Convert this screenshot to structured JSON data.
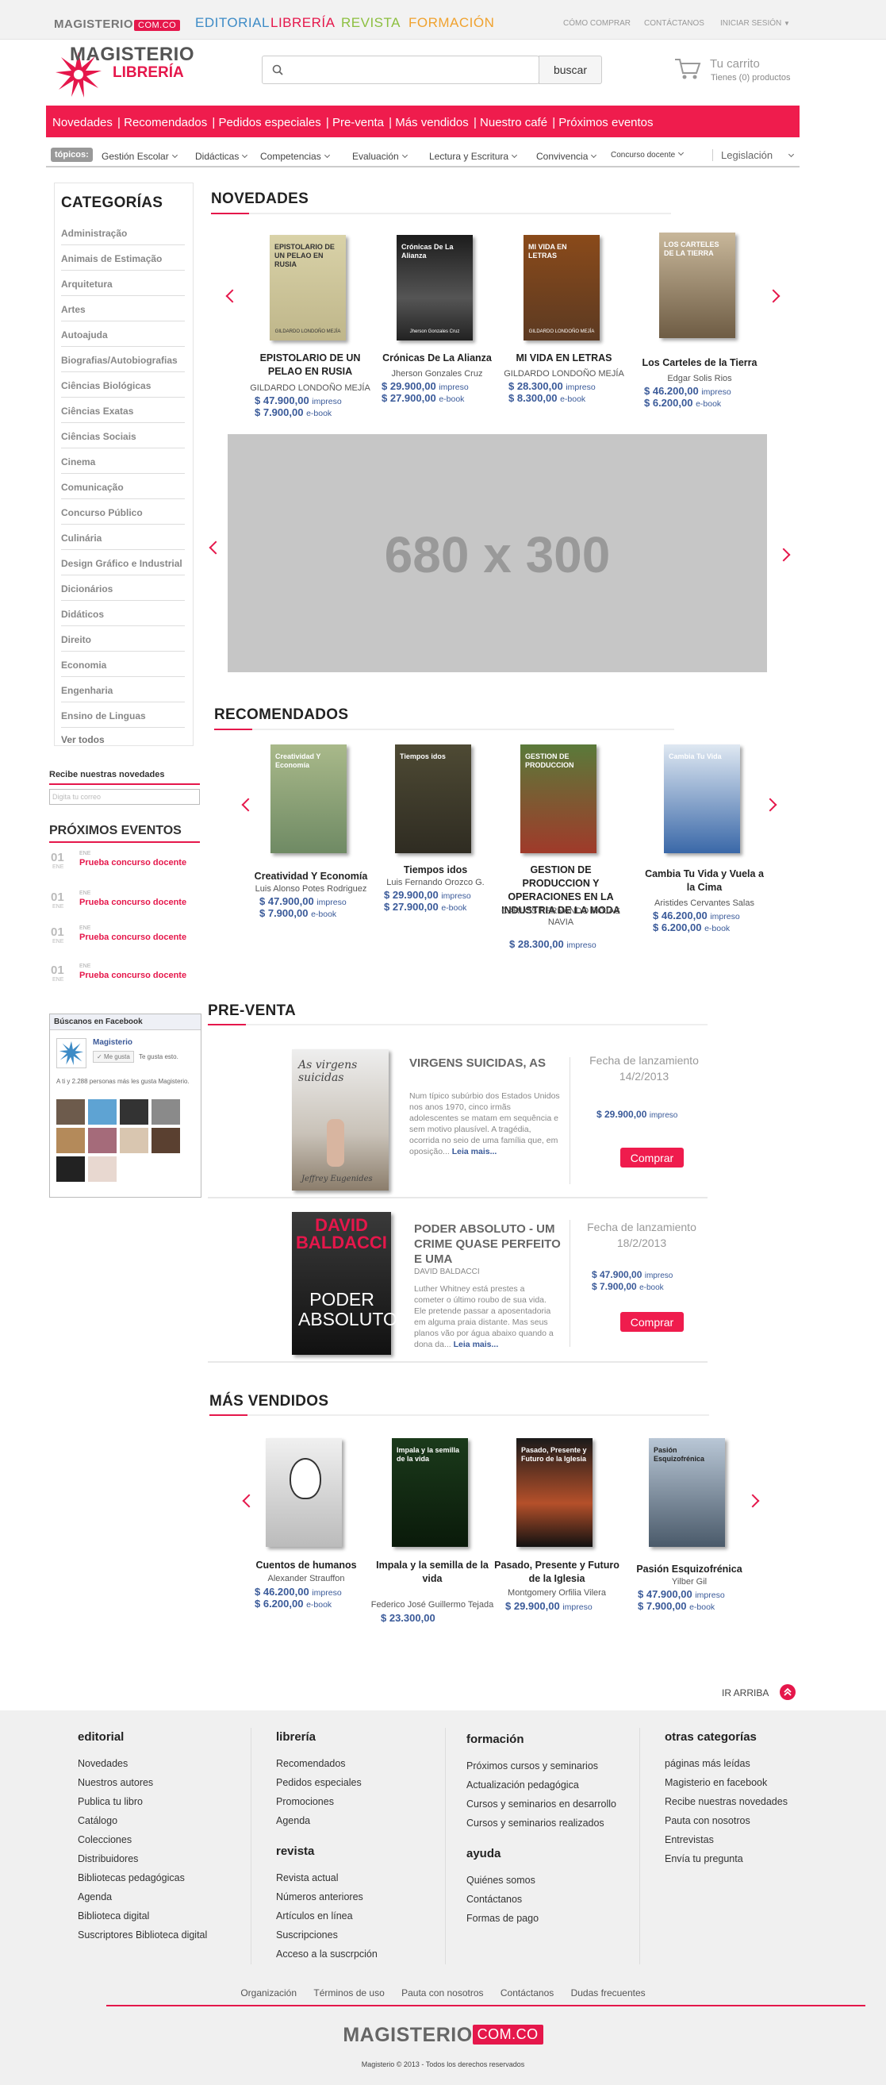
{
  "topbar": {
    "brand": "MAGISTERIO",
    "brand_suffix": "COM.CO",
    "nav": [
      {
        "label": "EDITORIAL",
        "color": "#3d8bc6"
      },
      {
        "label": "LIBRERÍA",
        "color": "#e5174b"
      },
      {
        "label": "REVISTA",
        "color": "#8cbf3f"
      },
      {
        "label": "FORMACIÓN",
        "color": "#f0a22e"
      }
    ],
    "right": [
      "CÓMO COMPRAR",
      "CONTÁCTANOS",
      "INICIAR SESIÓN"
    ]
  },
  "logo": {
    "line1": "MAGISTERIO",
    "line2": "LIBRERÍA"
  },
  "search": {
    "placeholder": "",
    "button": "buscar"
  },
  "cart": {
    "title": "Tu carrito",
    "status": "Tienes (0) productos"
  },
  "rednav": [
    "Novedades",
    "Recomendados",
    "Pedidos especiales",
    "Pre-venta",
    "Más vendidos",
    "Nuestro café",
    "Próximos eventos"
  ],
  "topics": {
    "label": "tópicos:",
    "items": [
      "Gestión Escolar",
      "Didácticas",
      "Competencias",
      "Evaluación",
      "Lectura y Escritura",
      "Convivencia",
      "Concurso docente",
      "Legislación"
    ]
  },
  "sidebar": {
    "title": "CATEGORÍAS",
    "items": [
      "Administração",
      "Animais de Estimação",
      "Arquitetura",
      "Artes",
      "Autoajuda",
      "Biografias/Autobiografias",
      "Ciências Biológicas",
      "Ciências Exatas",
      "Ciências Sociais",
      "Cinema",
      "Comunicação",
      "Concurso Público",
      "Culinária",
      "Design Gráfico e Industrial",
      "Dicionários",
      "Didáticos",
      "Direito",
      "Economia",
      "Engenharia",
      "Ensino de Linguas"
    ],
    "see_all": "Ver todos"
  },
  "novedades": {
    "title": "NOVEDADES",
    "books": [
      {
        "title": "EPISTOLARIO DE UN PELAO EN RUSIA",
        "author": "GILDARDO LONDOÑO MEJÍA",
        "price1": "$ 47.900,00",
        "type1": "impreso",
        "price2": "$  7.900,00",
        "type2": "e-book",
        "cover_title": "EPISTOLARIO DE UN PELAO EN RUSIA",
        "cover_author": "GILDARDO LONDOÑO MEJÍA"
      },
      {
        "title": "Crónicas De La Alianza",
        "author": "Jherson Gonzales Cruz",
        "price1": "$ 29.900,00",
        "type1": "impreso",
        "price2": "$ 27.900,00",
        "type2": "e-book",
        "cover_title": "Crónicas De La Alianza",
        "cover_author": "Jherson Gonzales Cruz"
      },
      {
        "title": "MI VIDA EN LETRAS",
        "author": "GILDARDO LONDOÑO MEJÍA",
        "price1": "$ 28.300,00",
        "type1": "impreso",
        "price2": "$  8.300,00",
        "type2": "e-book",
        "cover_title": "MI VIDA EN LETRAS",
        "cover_author": "GILDARDO LONDOÑO MEJÍA"
      },
      {
        "title": "Los Carteles de la Tierra",
        "author": "Edgar Solis Rios",
        "price1": "$ 46.200,00",
        "type1": "impreso",
        "price2": "$  6.200,00",
        "type2": "e-book",
        "cover_title": "LOS CARTELES DE LA TIERRA",
        "cover_author": ""
      }
    ]
  },
  "banner": {
    "text": "680 x 300"
  },
  "recomendados": {
    "title": "RECOMENDADOS",
    "books": [
      {
        "title": "Creatividad Y Economía",
        "author": "Luis Alonso Potes Rodriguez",
        "price1": "$ 47.900,00",
        "type1": "impreso",
        "price2": "$  7.900,00",
        "type2": "e-book",
        "cover_title": "Creatividad Y Economía"
      },
      {
        "title": "Tiempos idos",
        "author": "Luis Fernando Orozco G.",
        "price1": "$ 29.900,00",
        "type1": "impreso",
        "price2": "$ 27.900,00",
        "type2": "e-book",
        "cover_title": "Tiempos idos"
      },
      {
        "title": "GESTION DE PRODUCCION Y OPERACIONES EN LA INDUSTRIA DE LA MODA",
        "author": "CARLOS FERNANDO ROJAS NAVIA",
        "price1": "$ 28.300,00",
        "type1": "impreso",
        "price2": "",
        "type2": "",
        "cover_title": "GESTION DE PRODUCCION"
      },
      {
        "title": "Cambia Tu Vida y Vuela a la Cima",
        "author": "Aristides Cervantes Salas",
        "price1": "$ 46.200,00",
        "type1": "impreso",
        "price2": "$  6.200,00",
        "type2": "e-book",
        "cover_title": "Cambia Tu Vida"
      }
    ]
  },
  "newsletter": {
    "title": "Recibe nuestras novedades",
    "placeholder": "Digita tu correo"
  },
  "events": {
    "title": "PRÓXIMOS EVENTOS",
    "items": [
      {
        "day": "01",
        "month": "ENE",
        "name": "Prueba concurso docente"
      },
      {
        "day": "01",
        "month": "ENE",
        "name": "Prueba concurso docente"
      },
      {
        "day": "01",
        "month": "ENE",
        "name": "Prueba concurso docente"
      },
      {
        "day": "01",
        "month": "ENE",
        "name": "Prueba concurso docente"
      }
    ]
  },
  "facebook": {
    "header": "Búscanos en Facebook",
    "page": "Magisterio",
    "like": "Me gusta",
    "like_text": "Te gusta esto.",
    "people": "A ti y 2.288 personas más les gusta Magisterio."
  },
  "preventa": {
    "title": "PRE-VENTA",
    "date_label": "Fecha de lanzamiento",
    "buy": "Comprar",
    "items": [
      {
        "title": "VIRGENS SUICIDAS, AS",
        "author": "",
        "desc": "Num típico subúrbio dos Estados Unidos nos anos 1970, cinco irmãs adolescentes se matam em sequência e sem motivo plausível. A tragédia, ocorrida no seio de uma família que, em oposição...",
        "more": "Leia mais...",
        "date": "14/2/2013",
        "price1": "$ 29.900,00",
        "type1": "impreso",
        "price2": "",
        "type2": "",
        "cover_title": "As virgens suicidas",
        "cover_author": "Jeffrey Eugenides"
      },
      {
        "title": "PODER ABSOLUTO - UM CRIME QUASE PERFEITO E UMA",
        "author": "DAVID BALDACCI",
        "desc": "Luther Whitney está prestes a cometer o último roubo de sua vida. Ele pretende passar a aposentadoria em alguma praia distante. Mas seus planos vão por água abaixo quando a dona da...",
        "more": "Leia mais...",
        "date": "18/2/2013",
        "price1": "$ 47.900,00",
        "type1": "impreso",
        "price2": "$  7.900,00",
        "type2": "e-book",
        "cover_title": "PODER ABSOLUTO",
        "cover_author": "DAVID BALDACCI"
      }
    ]
  },
  "masvendidos": {
    "title": "MÁS VENDIDOS",
    "books": [
      {
        "title": "Cuentos de humanos",
        "author": "Alexander Strauffon",
        "price1": "$ 46.200,00",
        "type1": "impreso",
        "price2": "$  6.200,00",
        "type2": "e-book",
        "cover_title": ""
      },
      {
        "title": "Impala y la semilla de la vida",
        "author": "Federico José Guillermo Tejada",
        "price1": "$ 23.300,00",
        "type1": "",
        "price2": "",
        "type2": "",
        "cover_title": "Impala y la semilla de la vida"
      },
      {
        "title": "Pasado, Presente y Futuro de la Iglesia",
        "author": "Montgomery Orfilia Vilera",
        "price1": "$ 29.900,00",
        "type1": "impreso",
        "price2": "",
        "type2": "",
        "cover_title": "Pasado, Presente y Futuro de la Iglesia"
      },
      {
        "title": "Pasión Esquizofrénica",
        "author": "Yilber Gil",
        "price1": "$ 47.900,00",
        "type1": "impreso",
        "price2": "$  7.900,00",
        "type2": "e-book",
        "cover_title": "Pasión Esquizofrénica"
      }
    ]
  },
  "irarriba": "IR ARRIBA",
  "footer": {
    "editorial": {
      "title": "editorial",
      "items": [
        "Novedades",
        "Nuestros autores",
        "Publica tu libro",
        "Catálogo",
        "Colecciones",
        "Distribuidores",
        "Bibliotecas pedagógicas",
        "Agenda",
        "Biblioteca digital",
        "Suscriptores Biblioteca digital"
      ]
    },
    "libreria": {
      "title": "librería",
      "items": [
        "Recomendados",
        "Pedidos especiales",
        "Promociones",
        "Agenda"
      ]
    },
    "revista": {
      "title": "revista",
      "items": [
        "Revista actual",
        "Números anteriores",
        "Artículos en línea",
        "Suscripciones",
        "Acceso a la suscrpción"
      ]
    },
    "formacion": {
      "title": "formación",
      "items": [
        "Próximos cursos y seminarios",
        "Actualización pedagógica",
        "Cursos y seminarios en desarrollo",
        "Cursos y seminarios realizados"
      ]
    },
    "ayuda": {
      "title": "ayuda",
      "items": [
        "Quiénes somos",
        "Contáctanos",
        "Formas de pago"
      ]
    },
    "otras": {
      "title": "otras categorías",
      "items": [
        "páginas más leídas",
        "Magisterio en facebook",
        "Recibe nuestras novedades",
        "Pauta con nosotros",
        "Entrevistas",
        "Envía tu pregunta"
      ]
    },
    "bottom_links": [
      "Organización",
      "Términos de uso",
      "Pauta con nosotros",
      "Contáctanos",
      "Dudas frecuentes"
    ],
    "brand": "MAGISTERIO",
    "brand_suffix": "COM.CO",
    "copyright": "Magisterio © 2013 - Todos los derechos reservados"
  },
  "colors": {
    "accent": "#e5174b",
    "price": "#3a5a99"
  }
}
